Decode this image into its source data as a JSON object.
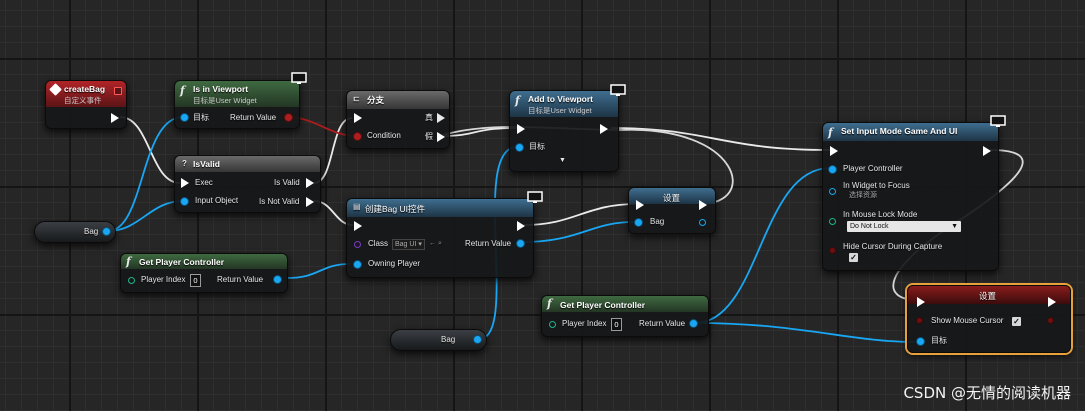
{
  "nodes": {
    "create_bag": {
      "title": "createBag",
      "subtitle": "自定义事件"
    },
    "is_in_viewport": {
      "title": "Is in Viewport",
      "subtitle": "目标是User Widget",
      "pin_target": "目标",
      "pin_return": "Return Value"
    },
    "branch": {
      "title": "分支",
      "pin_true": "真",
      "pin_condition": "Condition",
      "pin_false": "假"
    },
    "add_to_viewport": {
      "title": "Add to Viewport",
      "subtitle": "目标是User Widget",
      "pin_target": "目标"
    },
    "set_input_mode": {
      "title": "Set Input Mode Game And UI",
      "pin_player_controller": "Player Controller",
      "pin_widget_focus": "In Widget to Focus",
      "widget_focus_value": "选择资源",
      "pin_mouse_lock": "In Mouse Lock Mode",
      "mouse_lock_value": "Do Not Lock",
      "pin_hide_cursor": "Hide Cursor During Capture",
      "hide_cursor_checked": true
    },
    "is_valid": {
      "title": "IsValid",
      "pin_exec": "Exec",
      "pin_is_valid": "Is Valid",
      "pin_input_object": "Input Object",
      "pin_is_not_valid": "Is Not Valid"
    },
    "create_widget": {
      "title": "创建Bag UI控件",
      "pin_class": "Class",
      "class_value": "Bag UI",
      "pin_return": "Return Value",
      "pin_owning_player": "Owning Player"
    },
    "set_bag": {
      "title": "设置",
      "pin_bag": "Bag"
    },
    "get_player_controller_1": {
      "title": "Get Player Controller",
      "pin_player_index": "Player Index",
      "player_index_value": "0",
      "pin_return": "Return Value"
    },
    "get_player_controller_2": {
      "title": "Get Player Controller",
      "pin_player_index": "Player Index",
      "player_index_value": "0",
      "pin_return": "Return Value"
    },
    "set_show_mouse": {
      "title": "设置",
      "pin_show_mouse": "Show Mouse Cursor",
      "show_mouse_checked": true,
      "pin_target": "目标"
    },
    "bag_var_1": {
      "label": "Bag"
    },
    "bag_var_2": {
      "label": "Bag"
    }
  },
  "colors": {
    "object_pin": "#19a6f2",
    "bool_pin": "#ae1e1e",
    "struct_pin": "#1cb58a",
    "class_pin": "#7b3ac6",
    "exec_wire": "#ffffff"
  },
  "watermark": "CSDN @无情的阅读机器"
}
